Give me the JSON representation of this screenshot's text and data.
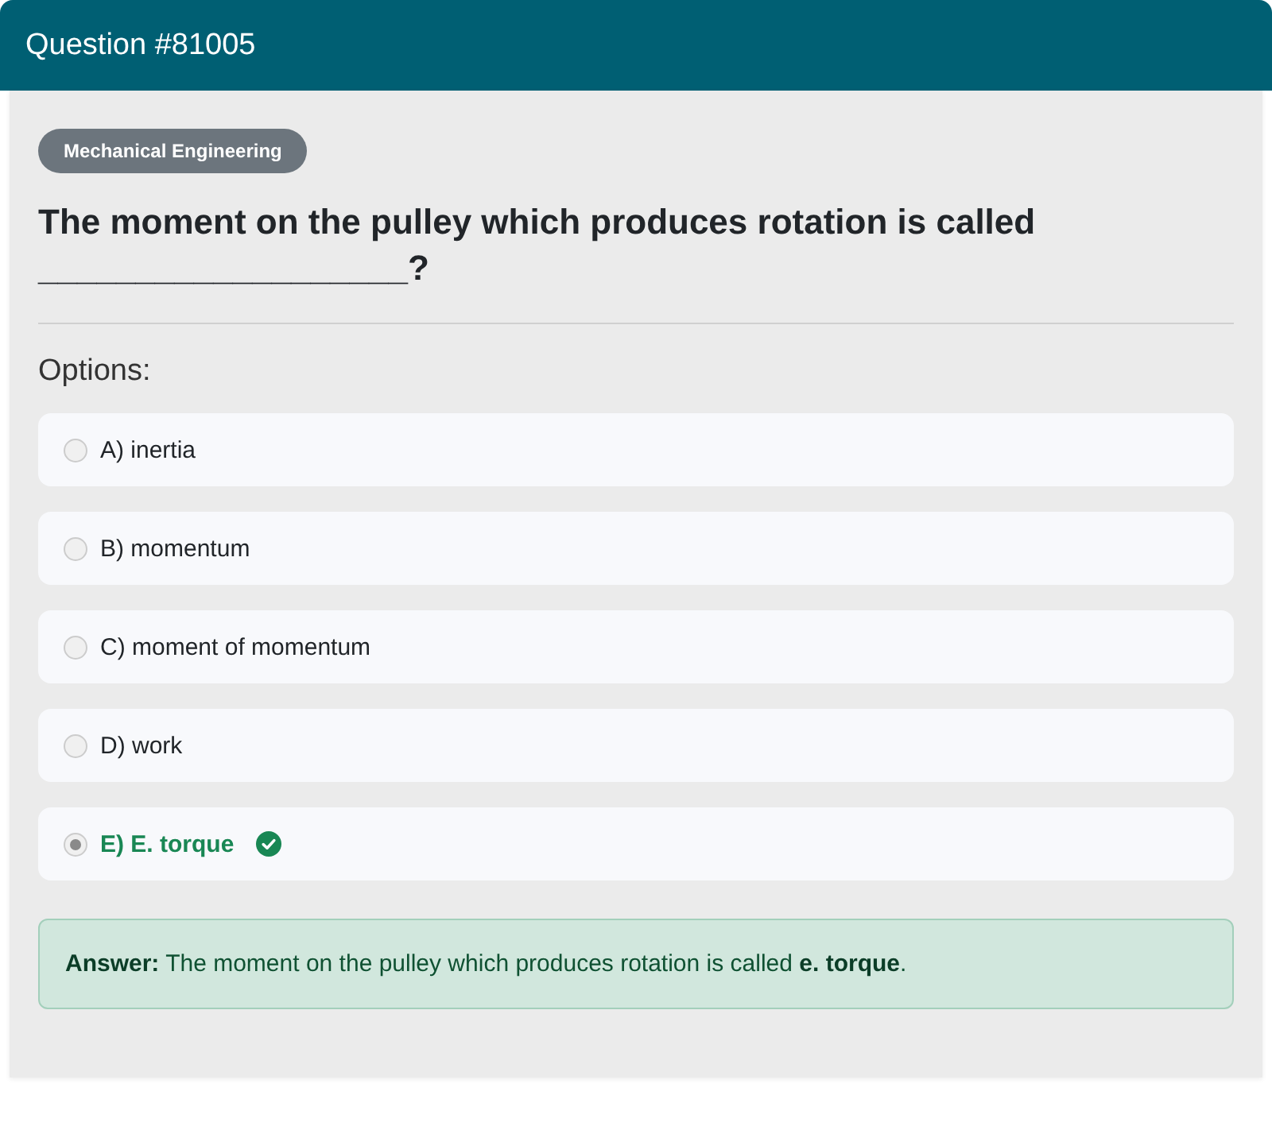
{
  "header": {
    "title": "Question #81005"
  },
  "category": "Mechanical Engineering",
  "question": "The moment on the pulley which produces rotation is called ___________________?",
  "options_label": "Options:",
  "options": [
    {
      "label": "A) inertia",
      "selected": false,
      "correct": false
    },
    {
      "label": "B) momentum",
      "selected": false,
      "correct": false
    },
    {
      "label": "C) moment of momentum",
      "selected": false,
      "correct": false
    },
    {
      "label": "D) work",
      "selected": false,
      "correct": false
    },
    {
      "label": "E) E. torque",
      "selected": true,
      "correct": true
    }
  ],
  "answer": {
    "text": "**Answer:** The moment on the pulley which produces rotation is called **e. torque**."
  }
}
